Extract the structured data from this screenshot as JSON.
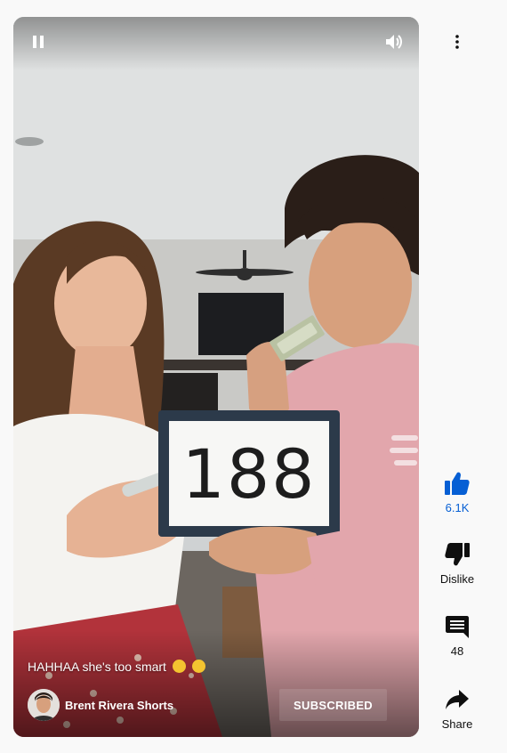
{
  "player": {
    "state": "playing",
    "caption": "HAHHAA she's too smart",
    "whiteboard_text": "188"
  },
  "channel": {
    "name": "Brent Rivera Shorts",
    "subscribe_label": "SUBSCRIBED"
  },
  "actions": {
    "like": {
      "label": "6.1K",
      "icon": "thumbs-up-icon",
      "active_color": "#065fd4"
    },
    "dislike": {
      "label": "Dislike",
      "icon": "thumbs-down-icon"
    },
    "comments": {
      "label": "48",
      "icon": "comment-icon"
    },
    "share": {
      "label": "Share",
      "icon": "share-arrow-icon"
    }
  },
  "icons": {
    "pause": "pause-icon",
    "volume": "volume-icon",
    "more": "more-vertical-icon"
  }
}
